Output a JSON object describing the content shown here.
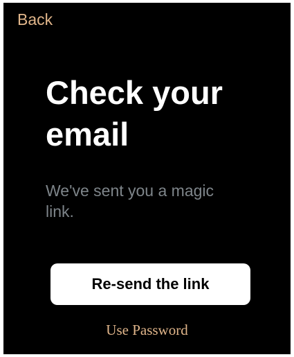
{
  "colors": {
    "background": "#000000",
    "accent": "#e0b58a",
    "muted": "#7e858a",
    "button_bg": "#ffffff",
    "button_text": "#000000"
  },
  "header": {
    "back_label": "Back"
  },
  "main": {
    "title_line1": "Check your",
    "title_line2": "email",
    "subtitle": "We've sent you a magic link."
  },
  "actions": {
    "resend_label": "Re-send the link",
    "use_password_label": "Use Password"
  }
}
